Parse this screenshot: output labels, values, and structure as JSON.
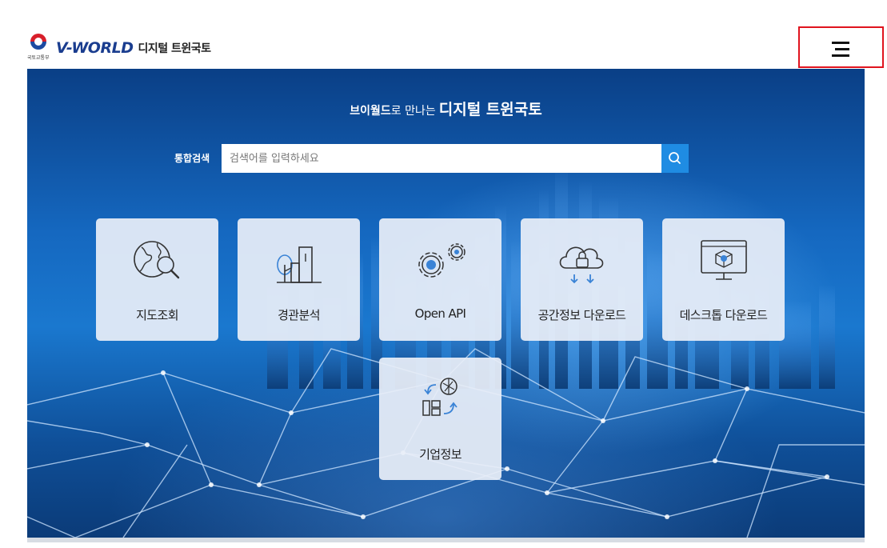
{
  "header": {
    "ministry": "국토교통부",
    "brand": "V-WORLD",
    "brand_sub": "디지털 트윈국토"
  },
  "menu": {
    "icon": "hamburger-menu-icon"
  },
  "hero": {
    "tagline_bold": "브이월드",
    "tagline_mid": "로 만나는",
    "tagline_big": "디지털 트윈국토"
  },
  "search": {
    "label": "통합검색",
    "placeholder": "검색어를 입력하세요",
    "icon": "search-icon"
  },
  "tiles": [
    {
      "label": "지도조회",
      "icon": "globe-search-icon"
    },
    {
      "label": "경관분석",
      "icon": "tree-building-icon"
    },
    {
      "label": "Open API",
      "icon": "gears-icon"
    },
    {
      "label": "공간정보 다운로드",
      "icon": "cloud-lock-download-icon"
    },
    {
      "label": "데스크톱 다운로드",
      "icon": "desktop-cube-icon"
    },
    {
      "label": "기업정보",
      "icon": "exchange-company-icon"
    }
  ],
  "colors": {
    "accent": "#1f8ce3",
    "brand": "#1a3d8f",
    "highlight_border": "#e0141e"
  }
}
